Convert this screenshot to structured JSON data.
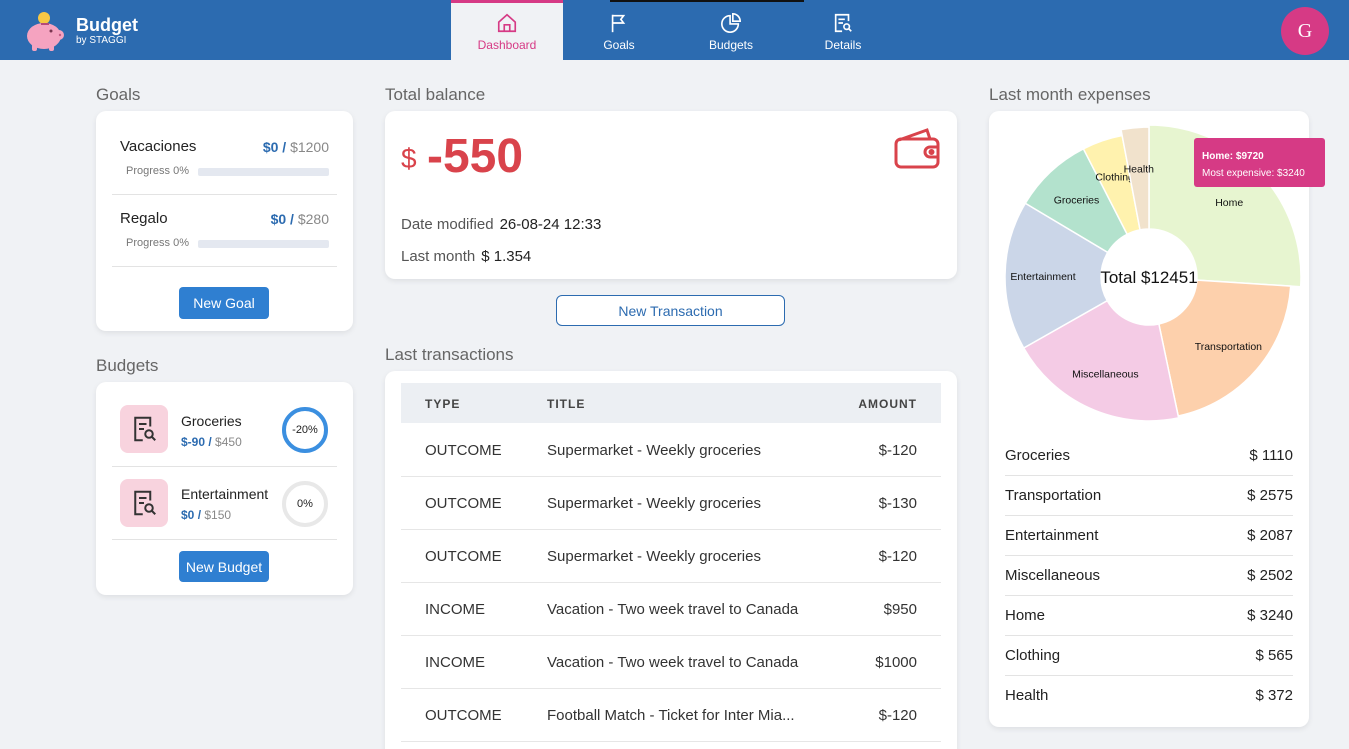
{
  "app": {
    "title": "Budget",
    "subtitle": "by STAGGI"
  },
  "nav": {
    "tabs": [
      {
        "label": "Dashboard",
        "icon": "home-icon",
        "active": true
      },
      {
        "label": "Goals",
        "icon": "flag-icon",
        "active": false
      },
      {
        "label": "Budgets",
        "icon": "pie-chart-icon",
        "active": false
      },
      {
        "label": "Details",
        "icon": "document-search-icon",
        "active": false
      }
    ]
  },
  "user": {
    "initial": "G"
  },
  "goals": {
    "title": "Goals",
    "items": [
      {
        "name": "Vacaciones",
        "current": "$0",
        "sep": " / ",
        "target": "$1200",
        "progress_label": "Progress 0%",
        "progress": 0
      },
      {
        "name": "Regalo",
        "current": "$0",
        "sep": " / ",
        "target": "$280",
        "progress_label": "Progress 0%",
        "progress": 0
      }
    ],
    "button": "New Goal"
  },
  "budgets": {
    "title": "Budgets",
    "items": [
      {
        "name": "Groceries",
        "spent": "$-90",
        "sep": " / ",
        "limit": "$450",
        "percent_label": "-20%",
        "icon": "receipt-search-icon"
      },
      {
        "name": "Entertainment",
        "spent": "$0",
        "sep": " / ",
        "limit": "$150",
        "percent_label": "0%",
        "icon": "receipt-search-icon"
      }
    ],
    "button": "New Budget"
  },
  "balance": {
    "title": "Total balance",
    "currency": "$",
    "value": "-550",
    "date_label": "Date modified",
    "date_value": "26-08-24 12:33",
    "last_month_label": "Last month",
    "last_month_value": "$ 1.354",
    "icon": "wallet-icon"
  },
  "new_transaction_button": "New Transaction",
  "transactions": {
    "title": "Last transactions",
    "columns": [
      "TYPE",
      "TITLE",
      "AMOUNT"
    ],
    "rows": [
      {
        "type": "OUTCOME",
        "title": "Supermarket - Weekly groceries",
        "amount": "$-120"
      },
      {
        "type": "OUTCOME",
        "title": "Supermarket - Weekly groceries",
        "amount": "$-130"
      },
      {
        "type": "OUTCOME",
        "title": "Supermarket - Weekly groceries",
        "amount": "$-120"
      },
      {
        "type": "INCOME",
        "title": "Vacation - Two week travel to Canada",
        "amount": "$950"
      },
      {
        "type": "INCOME",
        "title": "Vacation - Two week travel to Canada",
        "amount": "$1000"
      },
      {
        "type": "OUTCOME",
        "title": "Football Match - Ticket for Inter Mia...",
        "amount": "$-120"
      }
    ]
  },
  "expenses": {
    "title": "Last month expenses",
    "total_label": "Total $12451",
    "tooltip": {
      "line1": "Home: $9720",
      "line2": "Most expensive: $3240"
    },
    "list": [
      {
        "name": "Groceries",
        "value": "$ 1110"
      },
      {
        "name": "Transportation",
        "value": "$ 2575"
      },
      {
        "name": "Entertainment",
        "value": "$ 2087"
      },
      {
        "name": "Miscellaneous",
        "value": "$ 2502"
      },
      {
        "name": "Home",
        "value": "$ 3240"
      },
      {
        "name": "Clothing",
        "value": "$ 565"
      },
      {
        "name": "Health",
        "value": "$ 372"
      }
    ]
  },
  "chart_data": {
    "type": "pie",
    "categories": [
      "Home",
      "Transportation",
      "Miscellaneous",
      "Entertainment",
      "Groceries",
      "Clothing",
      "Health"
    ],
    "values": [
      3240,
      2575,
      2502,
      2087,
      1110,
      565,
      372
    ],
    "colors": [
      "#e7f5d0",
      "#fdd0ac",
      "#f4cbe5",
      "#cbd6e8",
      "#b3e2cd",
      "#fff2ae",
      "#f1e2cc"
    ],
    "title": "",
    "center_label": "Total $12451"
  },
  "colors": {
    "brand": "#2c6bb0",
    "accent": "#d63a85",
    "negative": "#d9434b",
    "button": "#2f7fd1"
  }
}
